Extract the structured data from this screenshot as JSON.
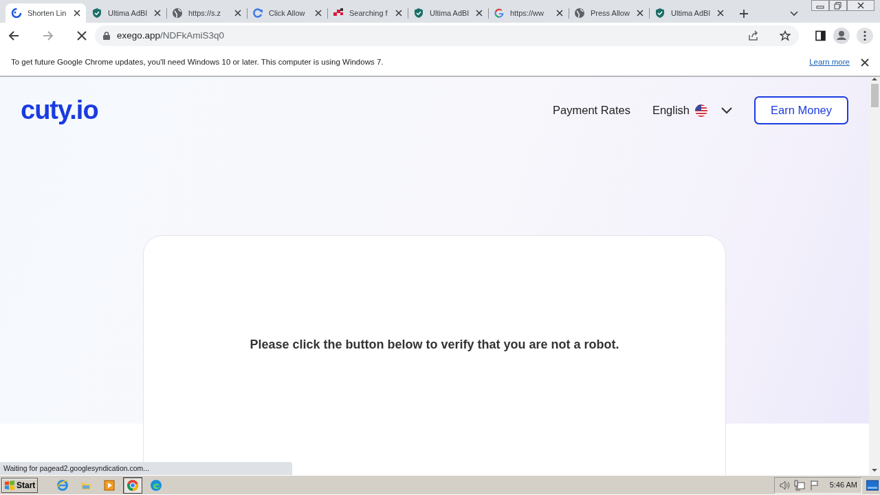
{
  "browser": {
    "tabs": [
      {
        "title": "Shorten Lin",
        "kind": "spinner",
        "selected": true
      },
      {
        "title": "Ultima AdBl",
        "kind": "shield",
        "selected": false
      },
      {
        "title": "https://s.z",
        "kind": "globe",
        "selected": false
      },
      {
        "title": "Click Allow",
        "kind": "refresh",
        "selected": false
      },
      {
        "title": "Searching f",
        "kind": "squares",
        "selected": false
      },
      {
        "title": "Ultima AdBl",
        "kind": "shield",
        "selected": false
      },
      {
        "title": "https://ww",
        "kind": "google",
        "selected": false
      },
      {
        "title": "Press Allow",
        "kind": "globe",
        "selected": false
      },
      {
        "title": "Ultima AdBl",
        "kind": "shield",
        "selected": false
      }
    ],
    "address": {
      "host": "exego.app",
      "path": "/NDFkAmiS3q0"
    },
    "infobar": {
      "message": "To get future Google Chrome updates, you'll need Windows 10 or later. This computer is using Windows 7.",
      "link": "Learn more"
    },
    "status": "Waiting for pagead2.googlesyndication.com..."
  },
  "page": {
    "logo": "cuty.io",
    "nav": [
      {
        "label": "Payment Rates"
      }
    ],
    "language": "English",
    "cta": "Earn Money",
    "message": "Please click the button below to verify that you are not a robot."
  },
  "taskbar": {
    "start": "Start",
    "apps": [
      {
        "kind": "ie",
        "active": false
      },
      {
        "kind": "folder",
        "active": false
      },
      {
        "kind": "media",
        "active": false
      },
      {
        "kind": "chrome",
        "active": true
      },
      {
        "kind": "edge",
        "active": false
      }
    ],
    "clock": "5:46 AM"
  }
}
